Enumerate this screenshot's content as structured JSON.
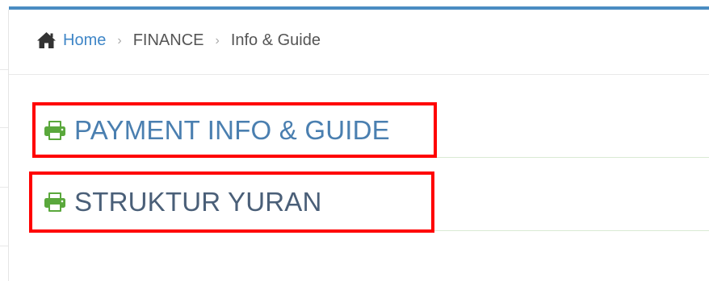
{
  "breadcrumb": {
    "home_label": "Home",
    "sep_1": "›",
    "section_label": "FINANCE",
    "sep_2": "›",
    "current_label": "Info & Guide",
    "home_icon": "home-icon"
  },
  "items": [
    {
      "label": "PAYMENT INFO & GUIDE",
      "icon": "printer-icon",
      "icon_color": "#5aa83c",
      "highlight_color": "#ff0000"
    },
    {
      "label": "STRUKTUR YURAN",
      "icon": "printer-icon",
      "icon_color": "#5aa83c",
      "highlight_color": "#ff0000"
    }
  ],
  "colors": {
    "accent": "#4a8cc2",
    "link": "#3f86c7",
    "item_text": "#4a7fb0"
  }
}
